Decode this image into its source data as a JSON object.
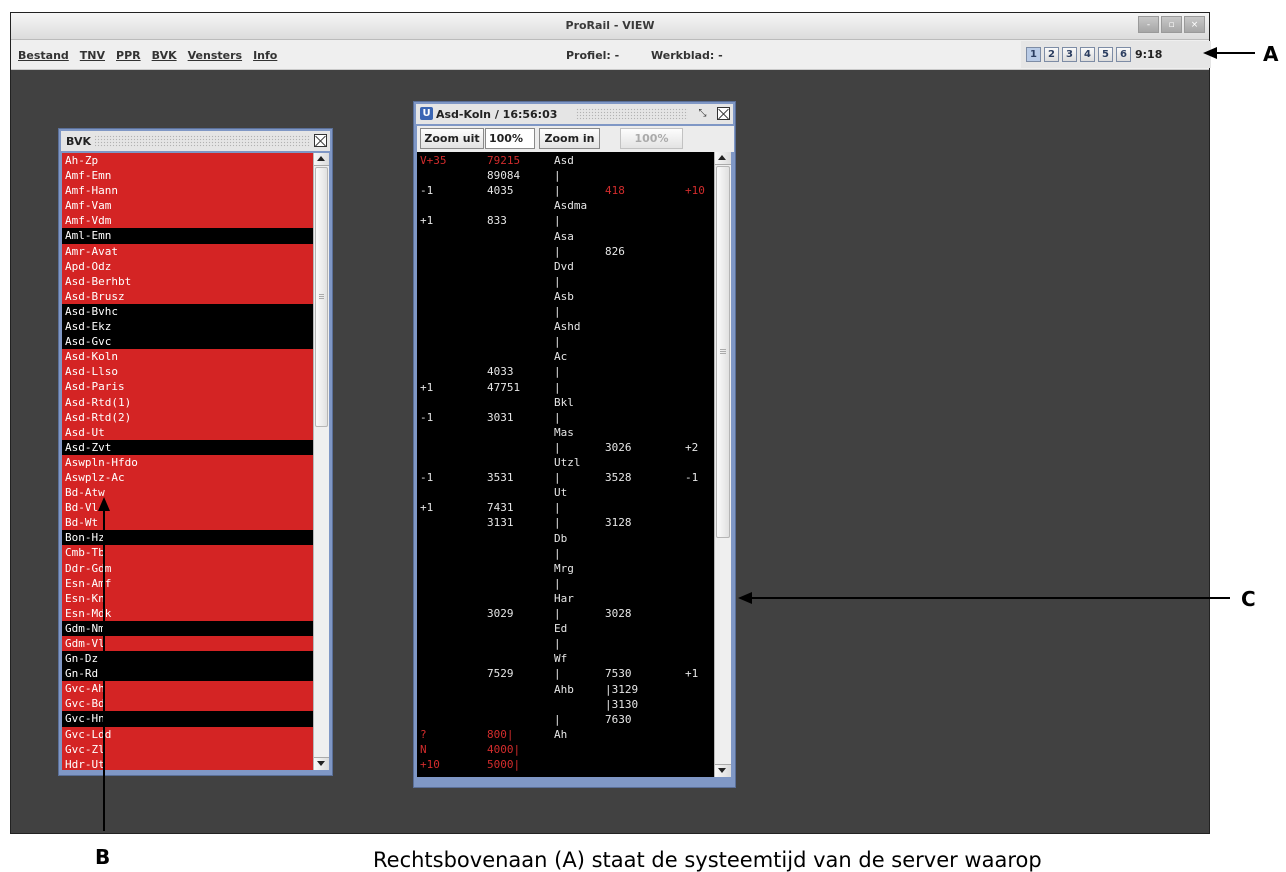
{
  "window": {
    "title": "ProRail - VIEW",
    "controls": [
      "-",
      "▫",
      "×"
    ]
  },
  "menubar": {
    "items": [
      "Bestand",
      "TNV",
      "PPR",
      "BVK",
      "Vensters",
      "Info"
    ],
    "profiel": "Profiel: -",
    "werkblad": "Werkblad: -",
    "workspaces": [
      "1",
      "2",
      "3",
      "4",
      "5",
      "6"
    ],
    "active_workspace": "1",
    "time": "9:18"
  },
  "bvk_window": {
    "title": "BVK",
    "items": [
      {
        "label": "Ah-Zp",
        "color": "red"
      },
      {
        "label": "Amf-Emn",
        "color": "red"
      },
      {
        "label": "Amf-Hann",
        "color": "red"
      },
      {
        "label": "Amf-Vam",
        "color": "red"
      },
      {
        "label": "Amf-Vdm",
        "color": "red"
      },
      {
        "label": "Aml-Emn",
        "color": "black"
      },
      {
        "label": "Amr-Avat",
        "color": "red"
      },
      {
        "label": "Apd-Odz",
        "color": "red"
      },
      {
        "label": "Asd-Berhbt",
        "color": "red"
      },
      {
        "label": "Asd-Brusz",
        "color": "red"
      },
      {
        "label": "Asd-Bvhc",
        "color": "black"
      },
      {
        "label": "Asd-Ekz",
        "color": "black"
      },
      {
        "label": "Asd-Gvc",
        "color": "black"
      },
      {
        "label": "Asd-Koln",
        "color": "red"
      },
      {
        "label": "Asd-Llso",
        "color": "red"
      },
      {
        "label": "Asd-Paris",
        "color": "red"
      },
      {
        "label": "Asd-Rtd(1)",
        "color": "red"
      },
      {
        "label": "Asd-Rtd(2)",
        "color": "red"
      },
      {
        "label": "Asd-Ut",
        "color": "red"
      },
      {
        "label": "Asd-Zvt",
        "color": "black"
      },
      {
        "label": "Aswpln-Hfdo",
        "color": "red"
      },
      {
        "label": "Aswplz-Ac",
        "color": "red"
      },
      {
        "label": "Bd-Atw",
        "color": "red"
      },
      {
        "label": "Bd-Vl",
        "color": "red"
      },
      {
        "label": "Bd-Wt",
        "color": "red"
      },
      {
        "label": "Bon-Hz",
        "color": "black"
      },
      {
        "label": "Cmb-Tb",
        "color": "red"
      },
      {
        "label": "Ddr-Gdm",
        "color": "red"
      },
      {
        "label": "Esn-Amf",
        "color": "red"
      },
      {
        "label": "Esn-Kn",
        "color": "red"
      },
      {
        "label": "Esn-Mdk",
        "color": "red"
      },
      {
        "label": "Gdm-Nm",
        "color": "black"
      },
      {
        "label": "Gdm-Vl",
        "color": "red"
      },
      {
        "label": "Gn-Dz",
        "color": "black"
      },
      {
        "label": "Gn-Rd",
        "color": "black"
      },
      {
        "label": "Gvc-Ah",
        "color": "red"
      },
      {
        "label": "Gvc-Bd",
        "color": "red"
      },
      {
        "label": "Gvc-Hn",
        "color": "black"
      },
      {
        "label": "Gvc-Ldd",
        "color": "red"
      },
      {
        "label": "Gvc-Zl",
        "color": "red"
      },
      {
        "label": "Hdr-Ut",
        "color": "red"
      }
    ]
  },
  "route_window": {
    "title": "Asd-Koln / 16:56:03",
    "toolbar": {
      "zoom_out": "Zoom uit",
      "zoom_value": "100%",
      "zoom_in": "Zoom in",
      "zoom_display": "100%"
    },
    "rows": [
      {
        "c1": "V+35",
        "c2": "79215",
        "c3": "Asd",
        "c1r": true,
        "c2r": true
      },
      {
        "c2": "89084",
        "c3": "|"
      },
      {
        "c1": "-1",
        "c2": "4035",
        "c3": "|",
        "c4": "418",
        "c5": "+10",
        "c4r": true,
        "c5r": true
      },
      {
        "c3": "Asdma"
      },
      {
        "c1": "+1",
        "c2": "833",
        "c3": "|"
      },
      {
        "c3": "Asa"
      },
      {
        "c3": "|",
        "c4": "826"
      },
      {
        "c3": "Dvd"
      },
      {
        "c3": "|"
      },
      {
        "c3": "Asb"
      },
      {
        "c3": "|"
      },
      {
        "c3": "Ashd"
      },
      {
        "c3": "|"
      },
      {
        "c3": "Ac"
      },
      {
        "c2": "4033",
        "c3": "|"
      },
      {
        "c1": "+1",
        "c2": "47751",
        "c3": "|"
      },
      {
        "c3": "Bkl"
      },
      {
        "c1": "-1",
        "c2": "3031",
        "c3": "|"
      },
      {
        "c3": "Mas"
      },
      {
        "c3": "|",
        "c4": "3026",
        "c5": "+2"
      },
      {
        "c3": "Utzl"
      },
      {
        "c1": "-1",
        "c2": "3531",
        "c3": "|",
        "c4": "3528",
        "c5": "-1"
      },
      {
        "c3": "Ut"
      },
      {
        "c1": "+1",
        "c2": "7431",
        "c3": "|"
      },
      {
        "c2": "3131",
        "c3": "|",
        "c4": "3128"
      },
      {
        "c3": "Db"
      },
      {
        "c3": "|"
      },
      {
        "c3": "Mrg"
      },
      {
        "c3": "|"
      },
      {
        "c3": "Har"
      },
      {
        "c2": "3029",
        "c3": "|",
        "c4": "3028"
      },
      {
        "c3": "Ed"
      },
      {
        "c3": "|"
      },
      {
        "c3": "Wf"
      },
      {
        "c2": "7529",
        "c3": "|",
        "c4": "7530",
        "c5": "+1"
      },
      {
        "c3": "Ahb",
        "c4": "|3129"
      },
      {
        "c4": "|3130"
      },
      {
        "c3": "|",
        "c4": "7630"
      },
      {
        "c1": "?",
        "c2": "800|",
        "c3": "Ah",
        "c1r": true,
        "c2r": true
      },
      {
        "c1": "N",
        "c2": "4000|",
        "c1r": true,
        "c2r": true
      },
      {
        "c1": "+10",
        "c2": "5000|",
        "c1r": true,
        "c2r": true
      }
    ]
  },
  "annotations": {
    "a": "A",
    "b": "B",
    "c": "C"
  },
  "caption": "Rechtsbovenaan (A) staat de systeemtijd van de server waarop"
}
